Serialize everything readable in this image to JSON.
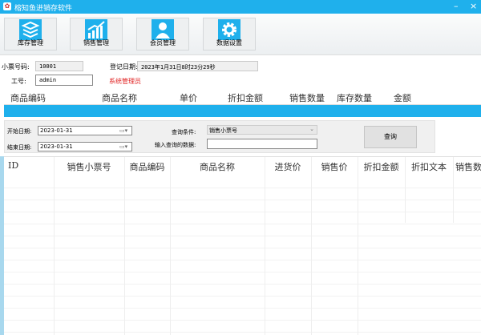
{
  "window": {
    "title": "榕知鱼进销存软件",
    "minimize": "–",
    "close": "×"
  },
  "toolbar": [
    {
      "label": "库存管理",
      "icon": "layers-icon"
    },
    {
      "label": "销售管理",
      "icon": "bar-chart-icon"
    },
    {
      "label": "会员管理",
      "icon": "user-icon"
    },
    {
      "label": "数据设置",
      "icon": "gear-icon"
    }
  ],
  "info": {
    "ticket_label": "小票号码:",
    "ticket_value": "10001",
    "date_label": "登记日期:",
    "date_value": "2023年1月31日8时23分29秒",
    "staff_label": "工号:",
    "staff_value": "admin",
    "role": "系统管理员"
  },
  "cart_table": {
    "columns": [
      "商品编码",
      "商品名称",
      "单价",
      "折扣金额",
      "销售数量",
      "库存数量",
      "金额"
    ]
  },
  "query": {
    "start_label": "开始日期:",
    "start_value": "2023-01-31",
    "end_label": "结束日期:",
    "end_value": "2023-01-31",
    "condition_label": "查询条件:",
    "condition_value": "销售小票号",
    "input_label": "输入查询的数据:",
    "input_value": "",
    "button": "查询"
  },
  "sales_table": {
    "columns": [
      "ID",
      "销售小票号",
      "商品编码",
      "商品名称",
      "进货价",
      "销售价",
      "折扣金额",
      "折扣文本",
      "销售数"
    ]
  },
  "colors": {
    "accent": "#1fb0ec",
    "role_text": "#e02020"
  }
}
